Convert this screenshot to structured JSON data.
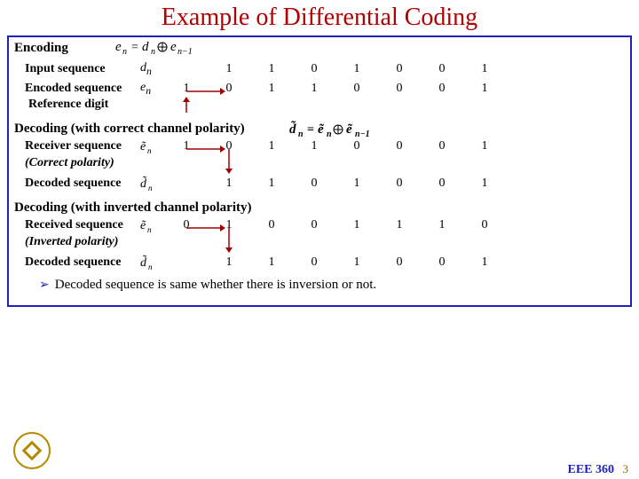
{
  "title": "Example of Differential Coding",
  "equations": {
    "encode": "e_n = d_n ⊕ e_{n-1}",
    "decode": "̃d_n = ̃e_n ⊕ ̃e_{n-1}"
  },
  "encoding": {
    "header": "Encoding",
    "input_label": "Input sequence",
    "input_sym": "d",
    "input_sub": "n",
    "input_bits": [
      "",
      "1",
      "1",
      "0",
      "1",
      "0",
      "0",
      "1"
    ],
    "encoded_label": "Encoded sequence",
    "encoded_sym": "e",
    "encoded_sub": "n",
    "encoded_bits": [
      "1",
      "0",
      "1",
      "1",
      "0",
      "0",
      "0",
      "1"
    ],
    "reference_label": "Reference digit"
  },
  "decoding_correct": {
    "header": "Decoding (with correct channel polarity)",
    "receiver_label": "Receiver sequence",
    "receiver_bits": [
      "1",
      "0",
      "1",
      "1",
      "0",
      "0",
      "0",
      "1"
    ],
    "polarity_label": "(Correct polarity)",
    "decoded_label": "Decoded sequence",
    "decoded_bits": [
      "",
      "1",
      "1",
      "0",
      "1",
      "0",
      "0",
      "1"
    ]
  },
  "decoding_inverted": {
    "header": "Decoding (with inverted channel polarity)",
    "received_label": "Received sequence",
    "received_bits": [
      "0",
      "1",
      "0",
      "0",
      "1",
      "1",
      "1",
      "0"
    ],
    "polarity_label": "(Inverted polarity)",
    "decoded_label": "Decoded sequence",
    "decoded_bits": [
      "",
      "1",
      "1",
      "0",
      "1",
      "0",
      "0",
      "1"
    ]
  },
  "conclusion": "Decoded sequence is same whether there is inversion or not.",
  "footer_course": "EEE 360",
  "footer_page": "3"
}
